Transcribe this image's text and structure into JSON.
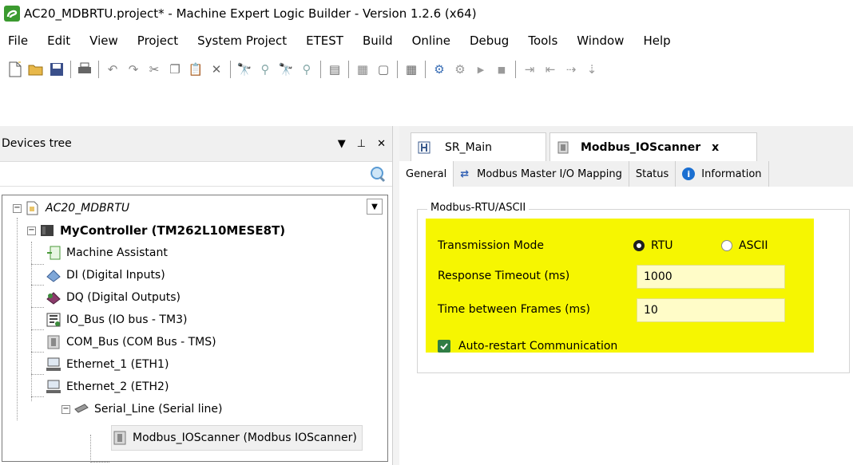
{
  "window": {
    "title": "AC20_MDBRTU.project* - Machine Expert Logic Builder - Version 1.2.6 (x64)",
    "colors": {
      "highlight": "#f6f601",
      "field_bg": "#fffcc8",
      "checkbox": "#2f7d44",
      "info_blue": "#1a6fd1",
      "logo_green": "#3b9a2f"
    }
  },
  "menu": {
    "items": [
      "File",
      "Edit",
      "View",
      "Project",
      "System Project",
      "ETEST",
      "Build",
      "Online",
      "Debug",
      "Tools",
      "Window",
      "Help"
    ]
  },
  "toolbar": {
    "icons": [
      "new-file-icon",
      "open-folder-icon",
      "save-icon",
      "print-icon",
      "undo-icon",
      "redo-icon",
      "cut-icon",
      "copy-icon",
      "paste-icon",
      "delete-icon",
      "find-icon",
      "find-replace-icon",
      "find-next-icon",
      "find-prev-icon",
      "browse-icon",
      "insert-object-icon",
      "new-object-icon",
      "visualization-icon",
      "login-icon",
      "logout-icon",
      "run-icon",
      "stop-icon",
      "indent-icon",
      "outdent-icon"
    ]
  },
  "devices_tree": {
    "title": "Devices tree",
    "search_placeholder": "",
    "nodes": [
      {
        "label": "AC20_MDBRTU",
        "icon": "project-icon",
        "expander": "−"
      },
      {
        "label": "MyController (TM262L10MESE8T)",
        "icon": "controller-icon",
        "expander": "−"
      },
      {
        "label": "Machine Assistant",
        "icon": "machine-assistant-icon"
      },
      {
        "label": "DI (Digital Inputs)",
        "icon": "digital-inputs-icon"
      },
      {
        "label": "DQ (Digital Outputs)",
        "icon": "digital-outputs-icon"
      },
      {
        "label": "IO_Bus (IO bus - TM3)",
        "icon": "io-bus-icon"
      },
      {
        "label": "COM_Bus (COM Bus - TMS)",
        "icon": "com-bus-icon"
      },
      {
        "label": "Ethernet_1 (ETH1)",
        "icon": "ethernet-icon"
      },
      {
        "label": "Ethernet_2 (ETH2)",
        "icon": "ethernet-icon"
      },
      {
        "label": "Serial_Line (Serial line)",
        "icon": "serial-line-icon",
        "expander": "−"
      },
      {
        "label": "Modbus_IOScanner (Modbus IOScanner)",
        "icon": "modbus-scanner-icon"
      }
    ]
  },
  "editor": {
    "tabs": [
      {
        "label": "SR_Main",
        "icon": "program-icon",
        "active": false
      },
      {
        "label": "Modbus_IOScanner",
        "icon": "modbus-scanner-icon",
        "active": true,
        "close": "x"
      }
    ],
    "sub_tabs": [
      {
        "label": "General",
        "active": true
      },
      {
        "label": "Modbus Master I/O Mapping",
        "icon": "mapping-icon"
      },
      {
        "label": "Status"
      },
      {
        "label": "Information",
        "icon": "info-icon"
      }
    ],
    "group_title": "Modbus-RTU/ASCII",
    "transmission_mode_label": "Transmission Mode",
    "transmission_options": [
      {
        "label": "RTU",
        "selected": true
      },
      {
        "label": "ASCII",
        "selected": false
      }
    ],
    "response_timeout_label": "Response Timeout (ms)",
    "response_timeout_value": "1000",
    "time_between_frames_label": "Time between Frames (ms)",
    "time_between_frames_value": "10",
    "auto_restart_label": "Auto-restart Communication",
    "auto_restart_checked": true
  }
}
